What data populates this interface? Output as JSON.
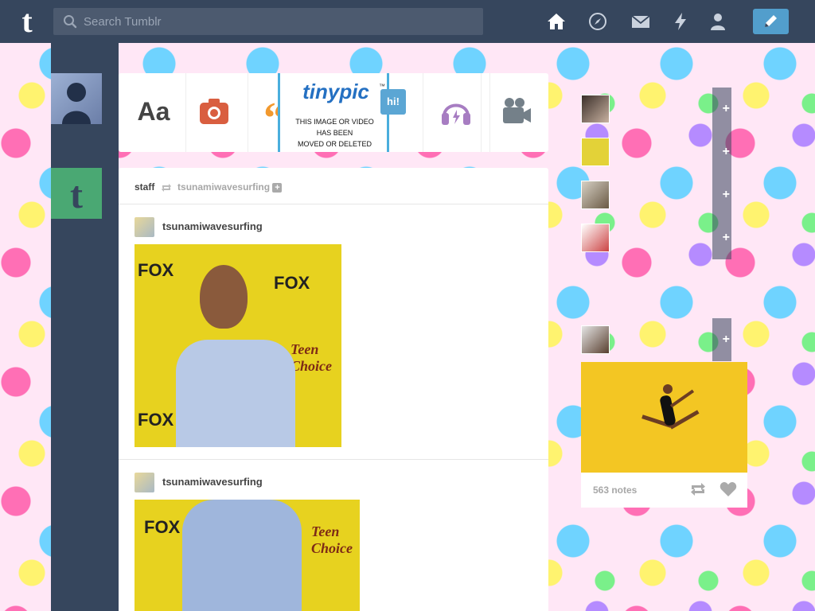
{
  "header": {
    "search_placeholder": "Search Tumblr",
    "nav": [
      "home-icon",
      "explore-icon",
      "inbox-icon",
      "activity-icon",
      "account-icon"
    ],
    "compose_icon": "pencil-icon"
  },
  "post_types": [
    {
      "name": "text",
      "label": "Aa",
      "color": "#444444"
    },
    {
      "name": "photo",
      "icon": "camera-icon",
      "color": "#d95e40"
    },
    {
      "name": "quote",
      "label": "“",
      "color": "#f2992e"
    },
    {
      "name": "link",
      "icon": "link-icon",
      "color": "#56bc8a"
    },
    {
      "name": "chat",
      "label": "hi!",
      "color": "#529ecc"
    },
    {
      "name": "audio",
      "icon": "headphones-icon",
      "color": "#a77dc2"
    },
    {
      "name": "video",
      "icon": "video-camera-icon",
      "color": "#748089"
    }
  ],
  "tinypic": {
    "logo": "tinypic",
    "tm": "™",
    "message_line1": "THIS IMAGE OR VIDEO",
    "message_line2": "HAS BEEN",
    "message_line3": "MOVED OR DELETED"
  },
  "post": {
    "reblogger": "staff",
    "reblogged_from": "tsunamiwavesurfing",
    "entries": [
      {
        "username": "tsunamiwavesurfing"
      },
      {
        "username": "tsunamiwavesurfing"
      }
    ],
    "photo_text": {
      "fox": "FOX",
      "teen": "Teen Choice"
    }
  },
  "radar": {
    "notes": "563 notes"
  }
}
